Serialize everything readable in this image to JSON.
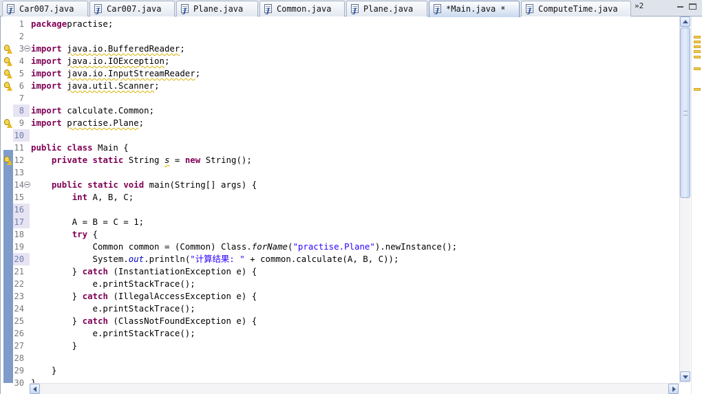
{
  "tabs": [
    {
      "label": "Car007.java",
      "active": false,
      "closable": false
    },
    {
      "label": "Car007.java",
      "active": false,
      "closable": false
    },
    {
      "label": "Plane.java",
      "active": false,
      "closable": false
    },
    {
      "label": "Common.java",
      "active": false,
      "closable": false
    },
    {
      "label": "Plane.java",
      "active": false,
      "closable": false
    },
    {
      "label": "*Main.java",
      "active": true,
      "closable": true
    },
    {
      "label": "ComputeTime.java",
      "active": false,
      "closable": false
    }
  ],
  "tab_overflow_count": "»2",
  "editor": {
    "lines": [
      {
        "n": "1",
        "t": [
          [
            "kw",
            "package"
          ],
          [
            "",
            "practise;"
          ]
        ]
      },
      {
        "n": "2",
        "t": []
      },
      {
        "n": "3",
        "warn": true,
        "fold": true,
        "t": [
          [
            "kw",
            "import"
          ],
          [
            "",
            " "
          ],
          [
            "wv",
            "java.io.BufferedReader"
          ],
          [
            "",
            ";"
          ]
        ]
      },
      {
        "n": "4",
        "warn": true,
        "t": [
          [
            "kw",
            "import"
          ],
          [
            "",
            " "
          ],
          [
            "wv",
            "java.io.IOException"
          ],
          [
            "",
            ";"
          ]
        ]
      },
      {
        "n": "5",
        "warn": true,
        "t": [
          [
            "kw",
            "import"
          ],
          [
            "",
            " "
          ],
          [
            "wv",
            "java.io.InputStreamReader"
          ],
          [
            "",
            ";"
          ]
        ]
      },
      {
        "n": "6",
        "warn": true,
        "t": [
          [
            "kw",
            "import"
          ],
          [
            "",
            " "
          ],
          [
            "wv",
            "java.util.Scanner"
          ],
          [
            "",
            ";"
          ]
        ]
      },
      {
        "n": "7",
        "t": []
      },
      {
        "n": "8",
        "hl": true,
        "t": [
          [
            "kw",
            "import"
          ],
          [
            "",
            " calculate.Common;"
          ]
        ]
      },
      {
        "n": "9",
        "warn": true,
        "t": [
          [
            "kw",
            "import"
          ],
          [
            "",
            " "
          ],
          [
            "wv",
            "practise.Plane"
          ],
          [
            "",
            ";"
          ]
        ]
      },
      {
        "n": "10",
        "hl": true,
        "t": []
      },
      {
        "n": "11",
        "t": [
          [
            "kw",
            "public"
          ],
          [
            "",
            " "
          ],
          [
            "kw",
            "class"
          ],
          [
            "",
            " Main {"
          ]
        ]
      },
      {
        "n": "12",
        "warn": true,
        "t": [
          [
            "",
            "    "
          ],
          [
            "kw",
            "private"
          ],
          [
            "",
            " "
          ],
          [
            "kw",
            "static"
          ],
          [
            "",
            " String "
          ],
          [
            "wvfld",
            "s"
          ],
          [
            "",
            " = "
          ],
          [
            "kw",
            "new"
          ],
          [
            "",
            " String();"
          ]
        ]
      },
      {
        "n": "13",
        "t": []
      },
      {
        "n": "14",
        "fold": true,
        "t": [
          [
            "",
            "    "
          ],
          [
            "kw",
            "public"
          ],
          [
            "",
            " "
          ],
          [
            "kw",
            "static"
          ],
          [
            "",
            " "
          ],
          [
            "kw",
            "void"
          ],
          [
            "",
            " main(String[] args) {"
          ]
        ]
      },
      {
        "n": "15",
        "t": [
          [
            "",
            "        "
          ],
          [
            "kw",
            "int"
          ],
          [
            "",
            " A, B, C;"
          ]
        ]
      },
      {
        "n": "16",
        "hl": true,
        "t": []
      },
      {
        "n": "17",
        "hl": true,
        "t": [
          [
            "",
            "        A = B = C = 1;"
          ]
        ]
      },
      {
        "n": "18",
        "t": [
          [
            "",
            "        "
          ],
          [
            "kw",
            "try"
          ],
          [
            "",
            " {"
          ]
        ]
      },
      {
        "n": "19",
        "t": [
          [
            "",
            "            Common common = (Common) Class."
          ],
          [
            "sm",
            "forName"
          ],
          [
            "",
            "("
          ],
          [
            "str",
            "\"practise.Plane\""
          ],
          [
            "",
            ").newInstance();"
          ]
        ]
      },
      {
        "n": "20",
        "hl": true,
        "t": [
          [
            "",
            "            System."
          ],
          [
            "fld",
            "out"
          ],
          [
            "",
            ".println("
          ],
          [
            "str",
            "\"计算结果: \""
          ],
          [
            "",
            " + common.calculate(A, B, C));"
          ]
        ]
      },
      {
        "n": "21",
        "t": [
          [
            "",
            "        } "
          ],
          [
            "kw",
            "catch"
          ],
          [
            "",
            " (InstantiationException e) {"
          ]
        ]
      },
      {
        "n": "22",
        "t": [
          [
            "",
            "            e.printStackTrace();"
          ]
        ]
      },
      {
        "n": "23",
        "t": [
          [
            "",
            "        } "
          ],
          [
            "kw",
            "catch"
          ],
          [
            "",
            " (IllegalAccessException e) {"
          ]
        ]
      },
      {
        "n": "24",
        "t": [
          [
            "",
            "            e.printStackTrace();"
          ]
        ]
      },
      {
        "n": "25",
        "t": [
          [
            "",
            "        } "
          ],
          [
            "kw",
            "catch"
          ],
          [
            "",
            " (ClassNotFoundException e) {"
          ]
        ]
      },
      {
        "n": "26",
        "t": [
          [
            "",
            "            e.printStackTrace();"
          ]
        ]
      },
      {
        "n": "27",
        "t": [
          [
            "",
            "        }"
          ]
        ]
      },
      {
        "n": "28",
        "t": []
      },
      {
        "n": "29",
        "t": [
          [
            "",
            "    }"
          ]
        ]
      },
      {
        "n": "30",
        "t": [
          [
            "",
            "}"
          ]
        ]
      }
    ]
  },
  "colors": {
    "keyword": "#7f0055",
    "string": "#2a00ff",
    "field": "#0000c0",
    "warning": "#d8b300"
  },
  "icons": [
    "java-file-icon",
    "close-icon",
    "minimize-icon",
    "maximize-icon",
    "warning-bulb-icon",
    "fold-icon",
    "scroll-up-icon",
    "scroll-down-icon"
  ]
}
